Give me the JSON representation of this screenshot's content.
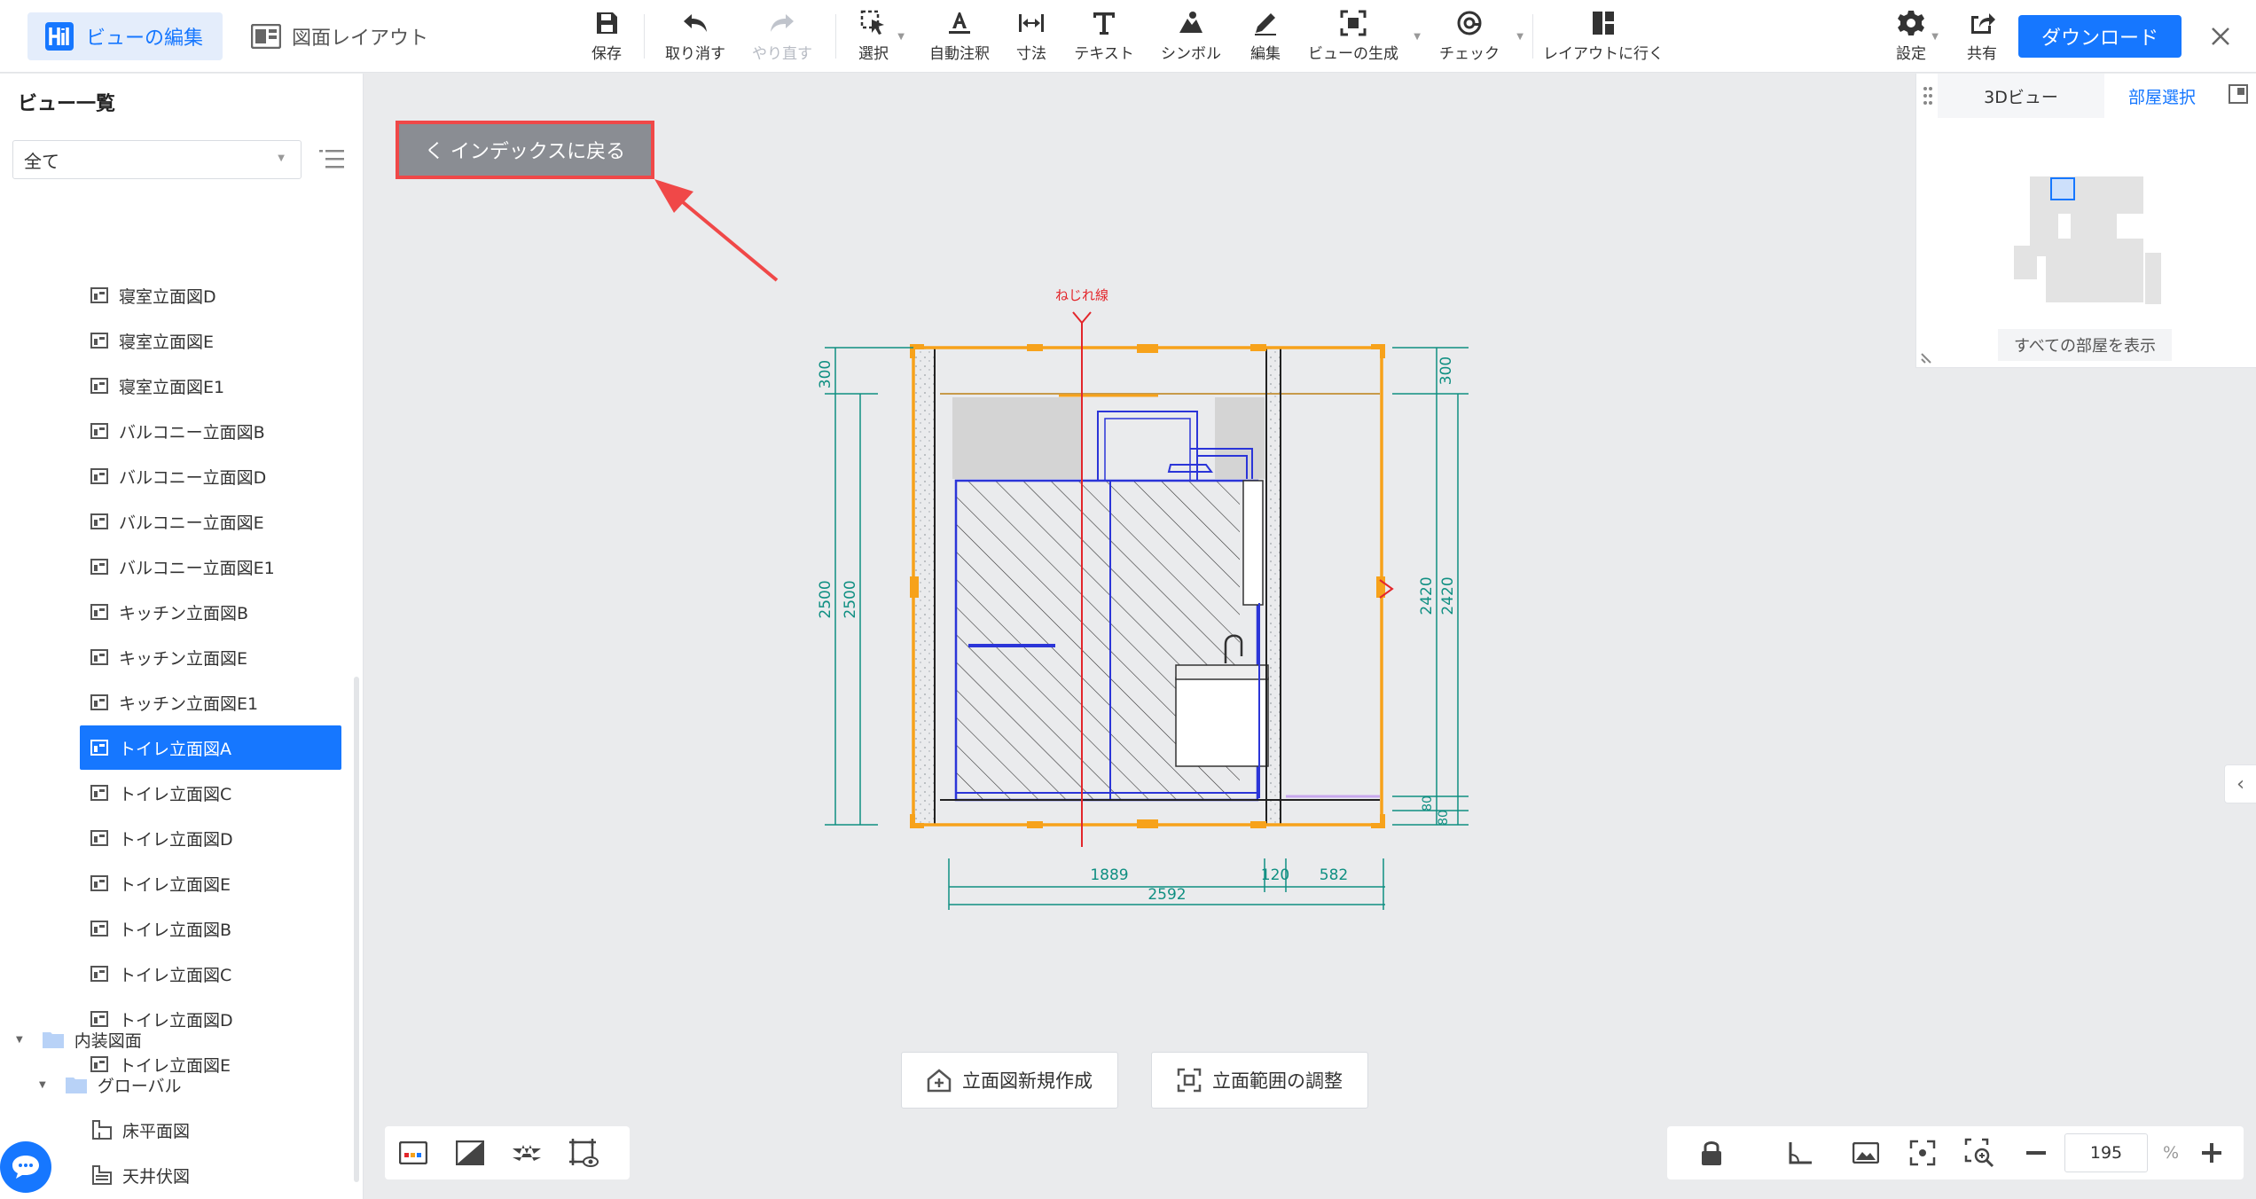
{
  "toolbar": {
    "edit_view_tab": "ビューの編集",
    "layout_tab": "図面レイアウト",
    "save": "保存",
    "undo": "取り消す",
    "redo": "やり直す",
    "select": "選択",
    "auto_annotate": "自動注釈",
    "dimension": "寸法",
    "text": "テキスト",
    "symbol": "シンボル",
    "edit": "編集",
    "generate_view": "ビューの生成",
    "check": "チェック",
    "go_to_layout": "レイアウトに行く",
    "settings": "設定",
    "share": "共有",
    "download": "ダウンロード"
  },
  "sidebar": {
    "title": "ビュー一覧",
    "filter_value": "全て",
    "items": [
      "寝室立面図D",
      "寝室立面図E",
      "寝室立面図E1",
      "バルコニー立面図B",
      "バルコニー立面図D",
      "バルコニー立面図E",
      "バルコニー立面図E1",
      "キッチン立面図B",
      "キッチン立面図E",
      "キッチン立面図E1",
      "トイレ立面図A",
      "トイレ立面図C",
      "トイレ立面図D",
      "トイレ立面図E",
      "トイレ立面図B",
      "トイレ立面図C",
      "トイレ立面図D",
      "トイレ立面図E"
    ],
    "active_item": "トイレ立面図A",
    "folder_interior": "内装図面",
    "folder_global": "グローバル",
    "floor_plan": "床平面図",
    "ceiling_plan": "天井伏図"
  },
  "canvas": {
    "back_button": "く インデックスに戻る",
    "twist_line_label": "ねじれ線",
    "dim_left_top": "300",
    "dim_left_a": "2500",
    "dim_left_b": "2500",
    "dim_right_top": "300",
    "dim_right_a": "2420",
    "dim_right_b": "2420",
    "dim_right_bottom_a": "80",
    "dim_right_bottom_b": "80",
    "dim_bottom_1": "1889",
    "dim_bottom_2": "120",
    "dim_bottom_3": "582",
    "dim_bottom_total": "2592",
    "new_elevation_button": "立面図新規作成",
    "adjust_range_button": "立面範囲の調整"
  },
  "minimap": {
    "tab_3d": "3Dビュー",
    "tab_room": "部屋選択",
    "show_all_rooms": "すべての部屋を表示"
  },
  "zoom": {
    "value": "195",
    "unit": "%"
  },
  "colors": {
    "accent": "#1677ff",
    "highlight_border": "#f04848",
    "frame_orange": "#f7a21b",
    "dim_teal": "#0f8f82",
    "hatch_blue": "#2b35d8"
  }
}
